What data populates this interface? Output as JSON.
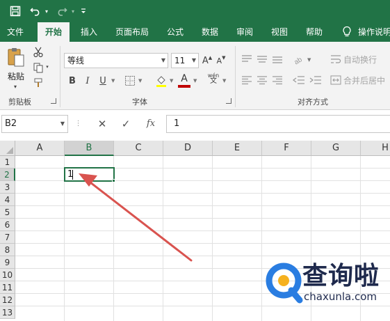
{
  "quick_access": {
    "save_icon": "save-icon",
    "undo_icon": "undo-icon",
    "redo_icon": "redo-icon",
    "customize_icon": "customize-qat-icon"
  },
  "tabs": [
    {
      "label": "文件"
    },
    {
      "label": "开始"
    },
    {
      "label": "插入"
    },
    {
      "label": "页面布局"
    },
    {
      "label": "公式"
    },
    {
      "label": "数据"
    },
    {
      "label": "审阅"
    },
    {
      "label": "视图"
    },
    {
      "label": "帮助"
    },
    {
      "label": "操作说明"
    }
  ],
  "ribbon": {
    "clipboard": {
      "group_label": "剪贴板",
      "paste_label": "粘贴"
    },
    "font": {
      "group_label": "字体",
      "font_name": "等线",
      "font_size": "11",
      "bold": "B",
      "italic": "I",
      "underline": "U",
      "grow": "A",
      "shrink": "A",
      "font_color_letter": "A",
      "phonetic": "wén",
      "font_color": "#c00000"
    },
    "alignment": {
      "group_label": "对齐方式",
      "wrap_text": "自动换行",
      "merge_center": "合并后居中"
    }
  },
  "formula_bar": {
    "name_box": "B2",
    "cancel": "✕",
    "enter": "✓",
    "fx": "fx",
    "content": "1"
  },
  "grid": {
    "columns": [
      "A",
      "B",
      "C",
      "D",
      "E",
      "F",
      "G",
      "H"
    ],
    "rows": [
      "1",
      "2",
      "3",
      "4",
      "5",
      "6",
      "7",
      "8",
      "9",
      "10",
      "11",
      "12",
      "13"
    ],
    "selected_column": "B",
    "selected_row": "2",
    "cells": {
      "B2": "1"
    }
  },
  "annotation": {
    "arrow_color": "#d9534f"
  },
  "watermark": {
    "text": "查询啦",
    "url": "chaxunla.com"
  },
  "colors": {
    "excel_green": "#217346"
  }
}
